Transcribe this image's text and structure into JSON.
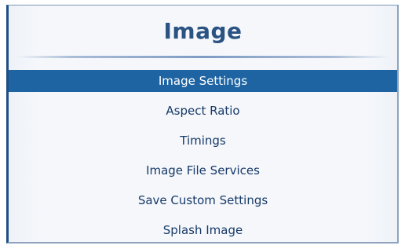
{
  "panel": {
    "title": "Image"
  },
  "menu": {
    "items": [
      {
        "label": "Image Settings",
        "selected": true
      },
      {
        "label": "Aspect Ratio",
        "selected": false
      },
      {
        "label": "Timings",
        "selected": false
      },
      {
        "label": "Image File Services",
        "selected": false
      },
      {
        "label": "Save Custom Settings",
        "selected": false
      },
      {
        "label": "Splash Image",
        "selected": false
      }
    ]
  },
  "colors": {
    "title": "#2a5383",
    "selected_bg": "#1e64a3",
    "item_text": "#173a68",
    "panel_border": "#1d4e86"
  }
}
